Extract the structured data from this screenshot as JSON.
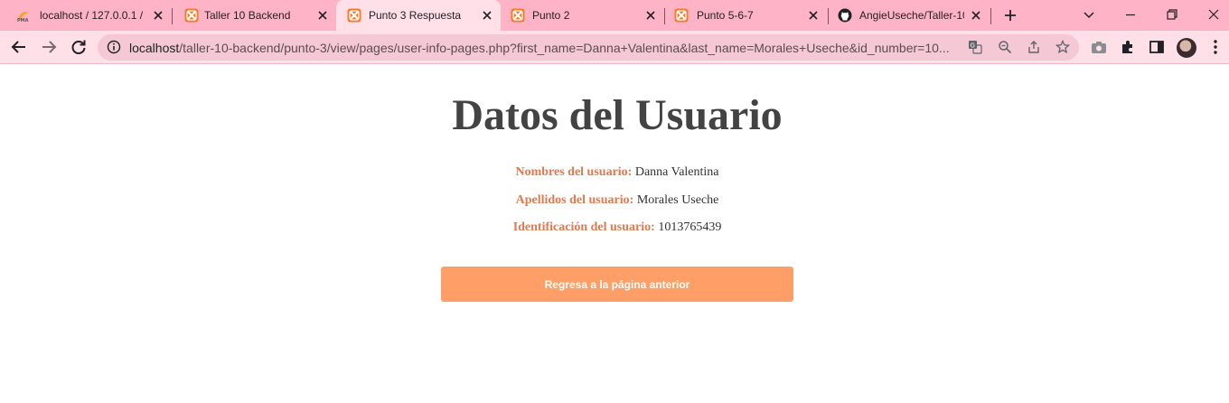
{
  "browser": {
    "tabs": [
      {
        "title": "localhost / 127.0.0.1 /",
        "favicon": "phpmyadmin-icon",
        "active": false
      },
      {
        "title": "Taller 10 Backend",
        "favicon": "xampp-icon",
        "active": false
      },
      {
        "title": "Punto 3 Respuesta",
        "favicon": "xampp-icon",
        "active": true
      },
      {
        "title": "Punto 2",
        "favicon": "xampp-icon",
        "active": false
      },
      {
        "title": "Punto 5-6-7",
        "favicon": "xampp-icon",
        "active": false
      },
      {
        "title": "AngieUseche/Taller-10",
        "favicon": "github-icon",
        "active": false
      }
    ],
    "address_host": "localhost",
    "address_path": "/taller-10-backend/punto-3/view/pages/user-info-pages.php?first_name=Danna+Valentina&last_name=Morales+Useche&id_number=10...",
    "colors": {
      "tabstrip": "#ffb3c6",
      "toolbar": "#ffe0e9",
      "omnibox": "#f4c9d5"
    }
  },
  "page": {
    "title": "Datos del Usuario",
    "fields": [
      {
        "label": "Nombres del usuario:",
        "value": "Danna Valentina"
      },
      {
        "label": "Apellidos del usuario:",
        "value": "Morales Useche"
      },
      {
        "label": "Identificación del usuario:",
        "value": "1013765439"
      }
    ],
    "back_button_label": "Regresa a la página anterior",
    "colors": {
      "title": "#434343",
      "label": "#e07a50",
      "button": "#ff9e66"
    }
  }
}
